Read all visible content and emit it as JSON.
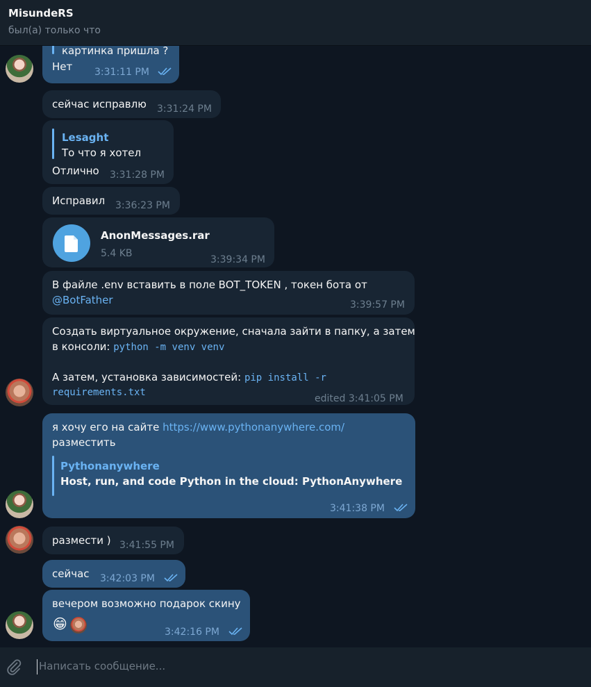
{
  "header": {
    "name": "MisundeRS",
    "status": "был(а) только что"
  },
  "messages": {
    "m1": {
      "quote": "картинка пришла ?",
      "text": "Нет",
      "time": "3:31:11 PM"
    },
    "m2": {
      "text": "сейчас исправлю",
      "time": "3:31:24 PM"
    },
    "m3": {
      "reply_name": "Lesaght",
      "reply_text": "То что я хотел",
      "text": "Отлично",
      "time": "3:31:28 PM"
    },
    "m4": {
      "text": "Исправил",
      "time": "3:36:23 PM"
    },
    "m5": {
      "file_name": "AnonMessages.rar",
      "file_size": "5.4 KB",
      "time": "3:39:34 PM"
    },
    "m6": {
      "text": "В файле .env вставить в поле BOT_TOKEN , токен бота от",
      "mention": "@BotFather",
      "time": "3:39:57 PM"
    },
    "m7": {
      "line1": "Создать виртуальное окружение, сначала зайти в папку, а затем",
      "line2_prefix": "в консоли: ",
      "code1": "python -m venv venv",
      "line3_prefix": "А затем, установка зависимостей: ",
      "code2a": "pip install -r",
      "code2b": "requirements.txt",
      "time": "edited 3:41:05 PM"
    },
    "m8": {
      "text_prefix": "я хочу его на сайте ",
      "url": "https://www.pythonanywhere.com/",
      "text_suffix": "разместить",
      "preview_site": "Pythonanywhere",
      "preview_title": "Host, run, and code Python in the cloud: PythonAnywhere",
      "time": "3:41:38 PM"
    },
    "m9": {
      "text": "размести )",
      "time": "3:41:55 PM"
    },
    "m10": {
      "text": "сейчас",
      "time": "3:42:03 PM"
    },
    "m11": {
      "text": "вечером возможно подарок скину",
      "emoji": "😁",
      "time": "3:42:16 PM"
    }
  },
  "input": {
    "placeholder": "Написать сообщение..."
  },
  "icons": {
    "attach": "paperclip-icon",
    "read": "double-check-icon",
    "file": "document-icon"
  },
  "colors": {
    "background": "#0e1621",
    "incoming": "#182533",
    "outgoing": "#2b5278",
    "accent": "#6ab3f3"
  }
}
